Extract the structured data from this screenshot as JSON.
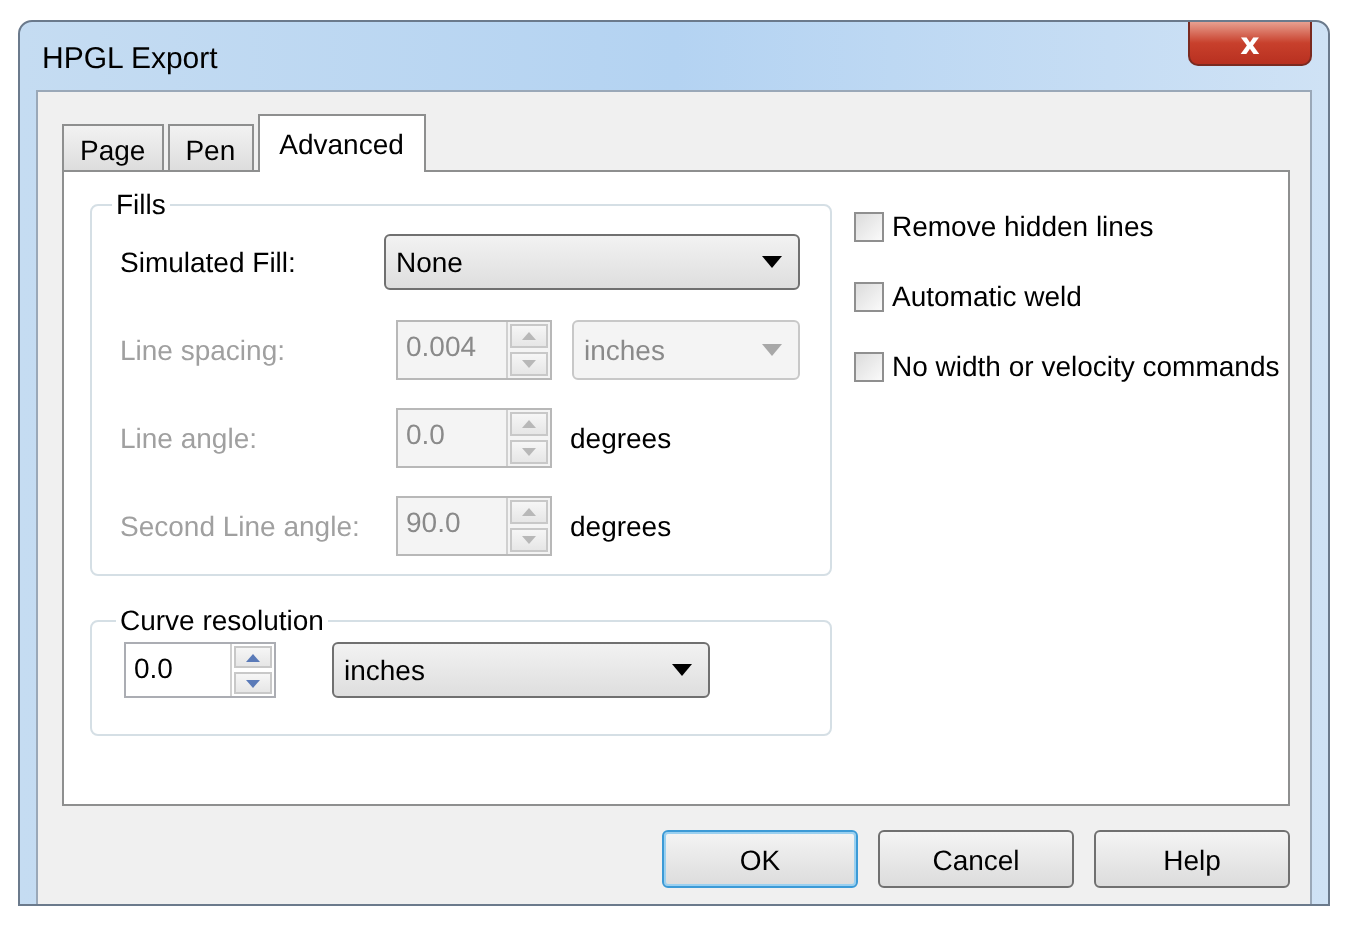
{
  "window": {
    "title": "HPGL Export",
    "close": "x"
  },
  "tabs": [
    {
      "label": "Page",
      "selected": false
    },
    {
      "label": "Pen",
      "selected": false
    },
    {
      "label": "Advanced",
      "selected": true
    }
  ],
  "fills": {
    "title": "Fills",
    "rows": [
      {
        "kind": "dropdown",
        "label": "Simulated Fill:",
        "value": "None",
        "disabled": false
      },
      {
        "kind": "spin",
        "label": "Line spacing:",
        "value": "0.004",
        "disabled": true,
        "unit": {
          "kind": "dropdown",
          "text": "inches",
          "disabled": true
        }
      },
      {
        "kind": "spin",
        "label": "Line angle:",
        "value": "0.0",
        "disabled": true,
        "unit": {
          "kind": "text",
          "text": "degrees",
          "disabled": false
        }
      },
      {
        "kind": "spin",
        "label": "Second Line angle:",
        "value": "90.0",
        "disabled": true,
        "unit": {
          "kind": "text",
          "text": "degrees",
          "disabled": false
        }
      }
    ]
  },
  "curve_resolution": {
    "title": "Curve resolution",
    "value": "0.0",
    "unit": "inches"
  },
  "options": [
    {
      "label": "Remove hidden lines",
      "checked": false
    },
    {
      "label": "Automatic weld",
      "checked": false
    },
    {
      "label": "No width or velocity commands",
      "checked": false
    }
  ],
  "buttons": [
    {
      "label": "OK",
      "focused": true
    },
    {
      "label": "Cancel",
      "focused": false
    },
    {
      "label": "Help",
      "focused": false
    }
  ]
}
